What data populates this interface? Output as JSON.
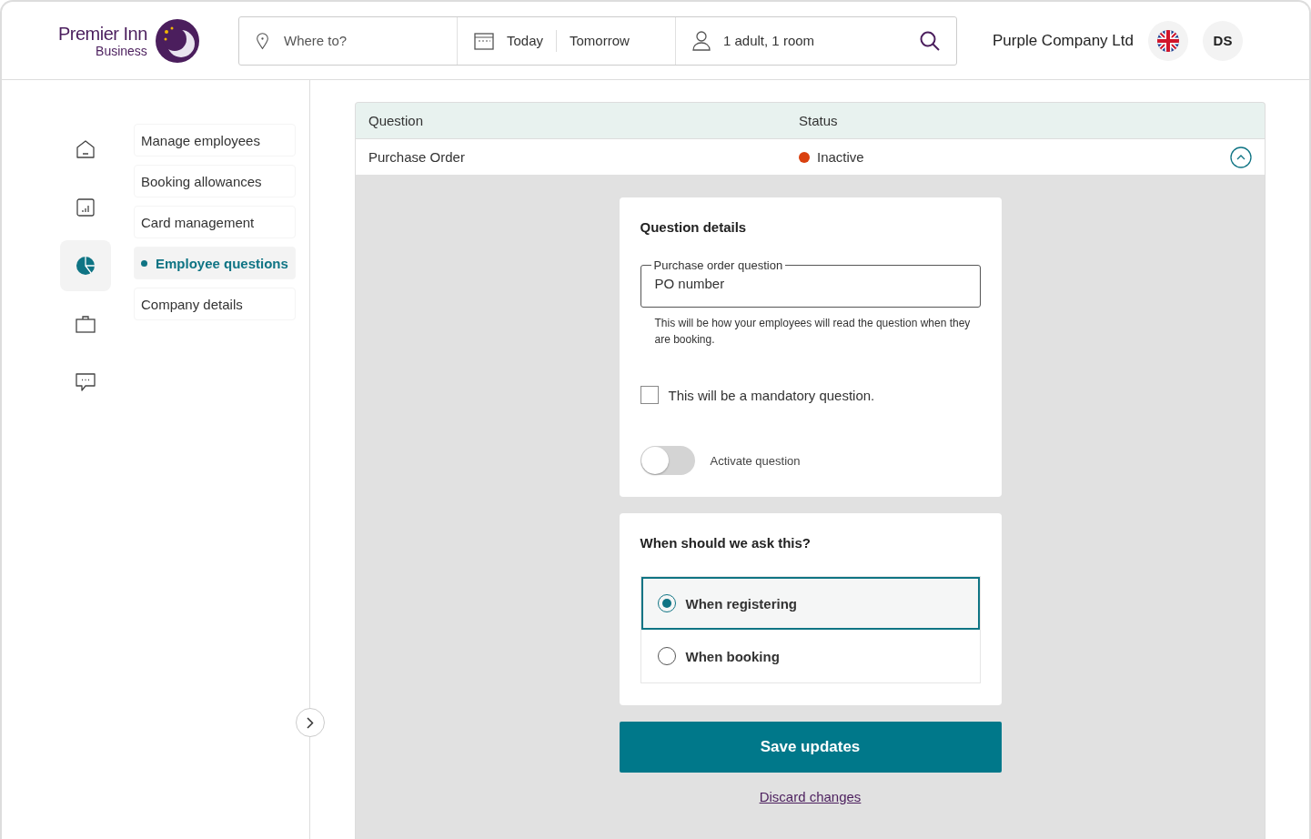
{
  "brand": {
    "name": "Premier Inn",
    "sub": "Business"
  },
  "search": {
    "destination": {
      "placeholder": "Where to?"
    },
    "dates": [
      "Today",
      "Tomorrow"
    ],
    "guests": "1 adult, 1 room"
  },
  "account": {
    "company": "Purple Company Ltd",
    "initials": "DS"
  },
  "rail": [
    {
      "kind": "home",
      "selected": false
    },
    {
      "kind": "chart",
      "selected": false
    },
    {
      "kind": "pie",
      "selected": true
    },
    {
      "kind": "bag",
      "selected": false
    },
    {
      "kind": "chat",
      "selected": false
    }
  ],
  "menu": [
    {
      "label": "Manage employees",
      "selected": false
    },
    {
      "label": "Booking allowances",
      "selected": false
    },
    {
      "label": "Card management",
      "selected": false
    },
    {
      "label": "Employee questions",
      "selected": true
    },
    {
      "label": "Company details",
      "selected": false
    }
  ],
  "table": {
    "columns": [
      "Question",
      "Status"
    ],
    "rows": [
      {
        "question": "Purchase Order",
        "status": "Inactive",
        "color": "#d9400f",
        "expanded": true
      }
    ]
  },
  "details": {
    "title": "Question details",
    "field": {
      "label": "Purchase order question",
      "value": "PO number"
    },
    "hint": "This will be how your employees will read the question when they are booking.",
    "mandatory": {
      "label": "This will be a mandatory question.",
      "checked": false
    },
    "activate": {
      "label": "Activate question",
      "on": false
    }
  },
  "timing": {
    "title": "When should we ask this?",
    "options": [
      {
        "label": "When registering",
        "selected": true
      },
      {
        "label": "When booking",
        "selected": false
      }
    ]
  },
  "actions": {
    "save": "Save updates",
    "discard": "Discard changes"
  }
}
